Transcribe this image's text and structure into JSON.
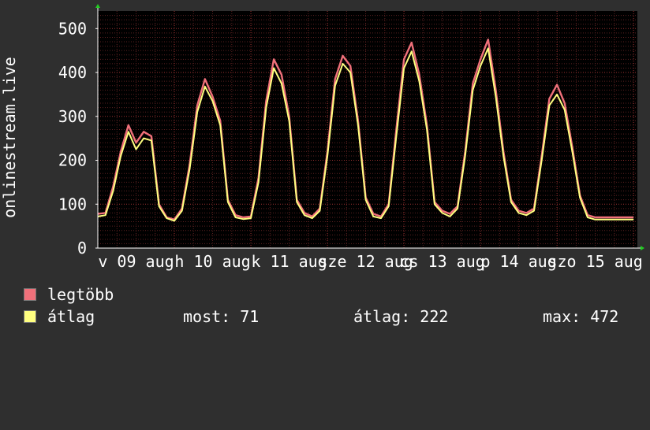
{
  "chart_data": {
    "type": "line",
    "ylabel": "onlinestream.live",
    "ylim": [
      0,
      540
    ],
    "yticks": [
      0,
      100,
      200,
      300,
      400,
      500
    ],
    "xticks": [
      "v 09 aug",
      "h 10 aug",
      "k 11 aug",
      "sze 12 aug",
      "cs 13 aug",
      "p 14 aug",
      "szo 15 aug"
    ],
    "xrange_days": [
      0,
      7.05
    ],
    "grid": true,
    "series": [
      {
        "name": "legtöbb",
        "color": "#f0707a",
        "x": [
          0,
          0.1,
          0.2,
          0.3,
          0.4,
          0.5,
          0.6,
          0.7,
          0.8,
          0.9,
          1.0,
          1.1,
          1.2,
          1.3,
          1.4,
          1.5,
          1.6,
          1.7,
          1.8,
          1.9,
          2.0,
          2.1,
          2.2,
          2.3,
          2.4,
          2.5,
          2.6,
          2.7,
          2.8,
          2.9,
          3.0,
          3.1,
          3.2,
          3.3,
          3.4,
          3.5,
          3.6,
          3.7,
          3.8,
          3.9,
          4.0,
          4.1,
          4.2,
          4.3,
          4.4,
          4.5,
          4.6,
          4.7,
          4.8,
          4.9,
          5.0,
          5.1,
          5.2,
          5.3,
          5.4,
          5.5,
          5.6,
          5.7,
          5.8,
          5.9,
          6.0,
          6.1,
          6.2,
          6.3,
          6.4,
          6.5,
          6.6,
          6.7,
          6.8,
          6.9,
          7.0
        ],
        "values": [
          78,
          80,
          140,
          220,
          280,
          240,
          265,
          255,
          100,
          70,
          65,
          90,
          190,
          325,
          385,
          345,
          290,
          110,
          75,
          70,
          72,
          160,
          335,
          430,
          395,
          300,
          110,
          80,
          72,
          90,
          220,
          385,
          438,
          415,
          290,
          115,
          78,
          72,
          100,
          270,
          430,
          468,
          395,
          280,
          105,
          85,
          78,
          95,
          220,
          375,
          430,
          475,
          360,
          220,
          110,
          85,
          80,
          90,
          210,
          340,
          372,
          330,
          230,
          120,
          75,
          70,
          70,
          70,
          70,
          70,
          70
        ]
      },
      {
        "name": "átlag",
        "color": "#ffff80",
        "x": [
          0,
          0.1,
          0.2,
          0.3,
          0.4,
          0.5,
          0.6,
          0.7,
          0.8,
          0.9,
          1.0,
          1.1,
          1.2,
          1.3,
          1.4,
          1.5,
          1.6,
          1.7,
          1.8,
          1.9,
          2.0,
          2.1,
          2.2,
          2.3,
          2.4,
          2.5,
          2.6,
          2.7,
          2.8,
          2.9,
          3.0,
          3.1,
          3.2,
          3.3,
          3.4,
          3.5,
          3.6,
          3.7,
          3.8,
          3.9,
          4.0,
          4.1,
          4.2,
          4.3,
          4.4,
          4.5,
          4.6,
          4.7,
          4.8,
          4.9,
          5.0,
          5.1,
          5.2,
          5.3,
          5.4,
          5.5,
          5.6,
          5.7,
          5.8,
          5.9,
          6.0,
          6.1,
          6.2,
          6.3,
          6.4,
          6.5,
          6.6,
          6.7,
          6.8,
          6.9,
          7.0
        ],
        "values": [
          72,
          75,
          130,
          210,
          265,
          225,
          250,
          245,
          95,
          68,
          62,
          85,
          180,
          310,
          368,
          335,
          280,
          105,
          70,
          66,
          68,
          150,
          320,
          410,
          375,
          290,
          105,
          75,
          68,
          85,
          210,
          370,
          420,
          400,
          280,
          110,
          72,
          68,
          95,
          255,
          410,
          448,
          380,
          270,
          100,
          80,
          72,
          90,
          210,
          360,
          415,
          455,
          345,
          210,
          105,
          80,
          75,
          85,
          200,
          325,
          350,
          315,
          220,
          115,
          70,
          65,
          65,
          65,
          65,
          65,
          65
        ]
      }
    ]
  },
  "legend": {
    "items": [
      {
        "label": "legtöbb",
        "color": "#f0707a"
      },
      {
        "label": "átlag",
        "color": "#ffff80"
      }
    ],
    "stats": {
      "most": "most: 71",
      "atlag": "átlag: 222",
      "max": "max: 472"
    }
  }
}
